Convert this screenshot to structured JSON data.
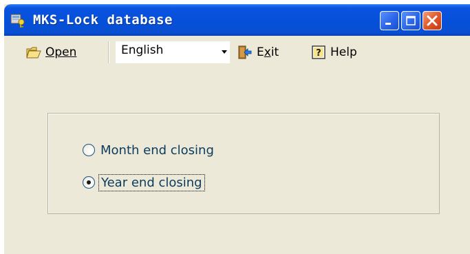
{
  "window": {
    "title": "MKS-Lock database"
  },
  "title_bar": {
    "app_icon": "database-key-icon",
    "buttons": [
      {
        "name": "minimize",
        "icon": "minimize-icon"
      },
      {
        "name": "maximize",
        "icon": "maximize-icon"
      },
      {
        "name": "close",
        "icon": "close-icon"
      }
    ]
  },
  "toolbar": {
    "open_label": "Open",
    "open_icon": "folder-open-icon",
    "language": {
      "selected": "English"
    },
    "exit_label": "Exit",
    "exit_icon": "exit-door-icon",
    "help_label": "Help",
    "help_icon": "help-icon"
  },
  "options": {
    "items": [
      {
        "label": "Month end closing",
        "checked": false
      },
      {
        "label": "Year end closing",
        "checked": true,
        "focused": true
      }
    ]
  },
  "colors": {
    "titlebar": "#0450d8",
    "window_bg": "#ece9d8",
    "close_button": "#e2572b",
    "radio_label": "#0b3b5c"
  }
}
